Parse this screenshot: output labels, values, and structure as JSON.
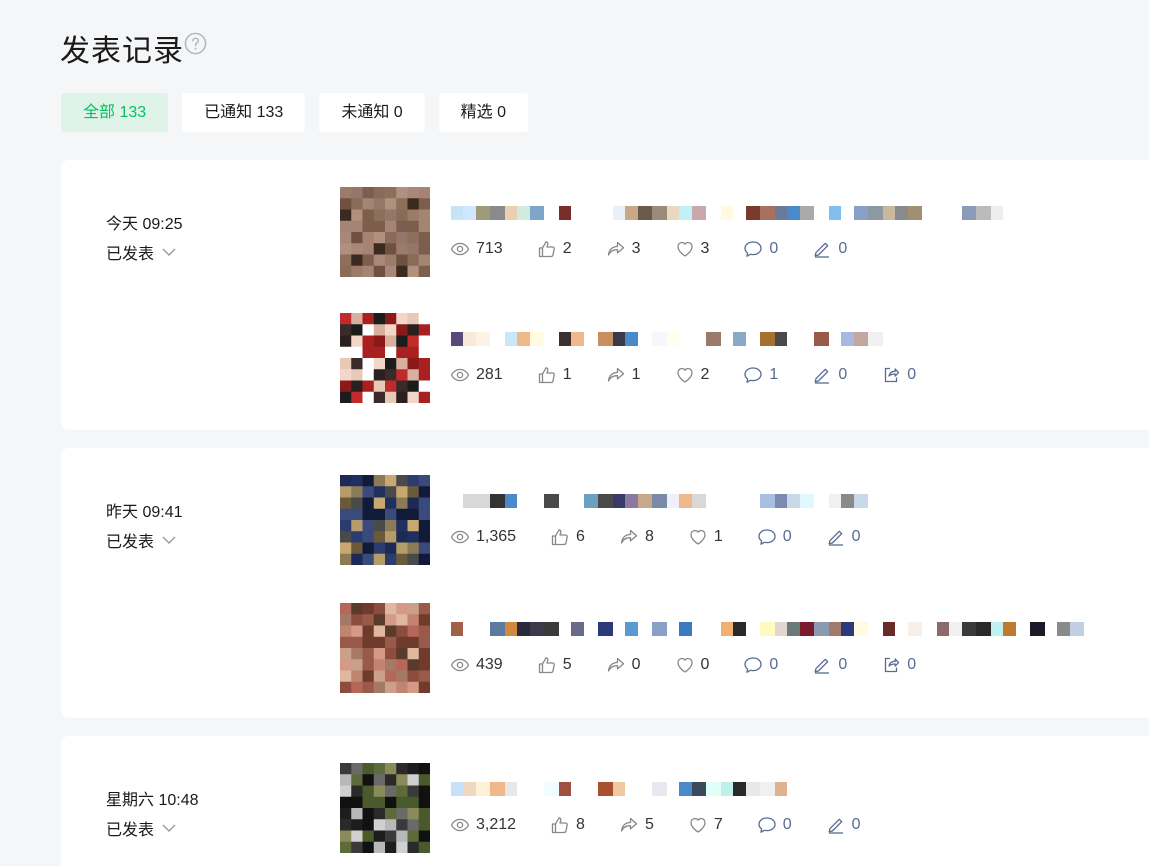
{
  "page": {
    "title": "发表记录"
  },
  "tabs": [
    {
      "label": "全部 133",
      "active": true
    },
    {
      "label": "已通知 133",
      "active": false
    },
    {
      "label": "未通知 0",
      "active": false
    },
    {
      "label": "精选 0",
      "active": false
    }
  ],
  "groups": [
    {
      "date": "今天 09:25",
      "status": "已发表",
      "posts": [
        {
          "views": "713",
          "likes": "2",
          "shares": "3",
          "favorites": "3",
          "comments": "0",
          "edits": "0"
        },
        {
          "views": "281",
          "likes": "1",
          "shares": "1",
          "favorites": "2",
          "comments": "1",
          "edits": "0",
          "exports": "0"
        }
      ]
    },
    {
      "date": "昨天 09:41",
      "status": "已发表",
      "posts": [
        {
          "views": "1,365",
          "likes": "6",
          "shares": "8",
          "favorites": "1",
          "comments": "0",
          "edits": "0"
        },
        {
          "views": "439",
          "likes": "5",
          "shares": "0",
          "favorites": "0",
          "comments": "0",
          "edits": "0",
          "exports": "0"
        }
      ]
    },
    {
      "date": "星期六 10:48",
      "status": "已发表",
      "posts": [
        {
          "views": "3,212",
          "likes": "8",
          "shares": "5",
          "favorites": "7",
          "comments": "0",
          "edits": "0"
        }
      ]
    }
  ],
  "colors": {
    "accent": "#07c160",
    "accent_bg": "#dff3e8",
    "link_blue": "#576b95"
  }
}
